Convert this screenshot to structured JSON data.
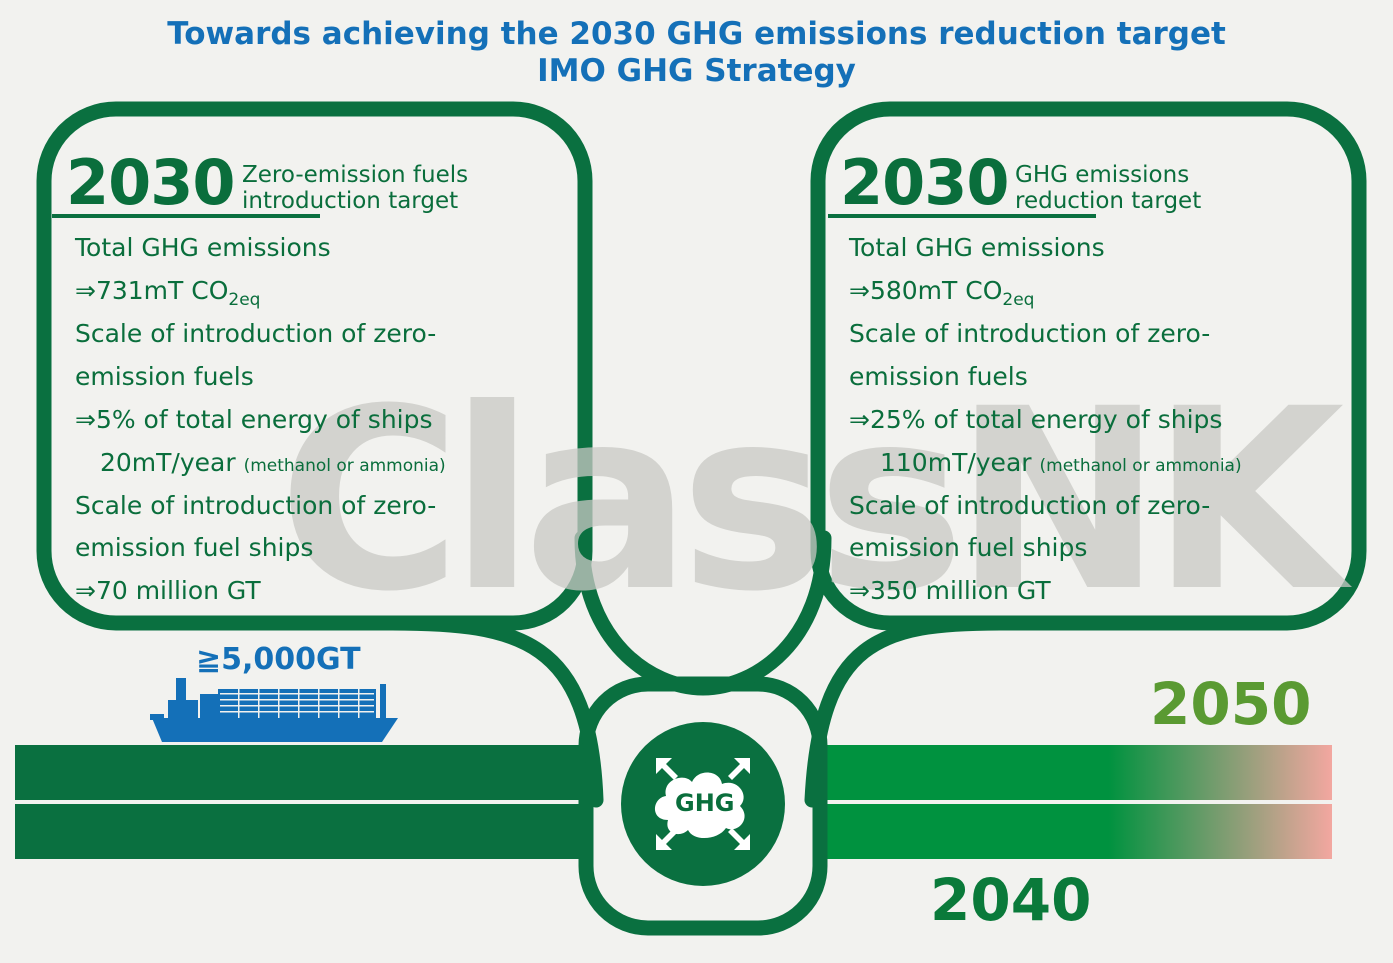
{
  "title_line1": "Towards achieving the 2030 GHG emissions reduction target",
  "title_line2": "IMO GHG Strategy",
  "watermark": "ClassNK",
  "left_box": {
    "year": "2030",
    "caption_line1": "Zero-emission fuels",
    "caption_line2": "introduction target",
    "l1": "Total GHG emissions",
    "l2": "⇒731mT CO",
    "l2_sub": "2eq",
    "l3": "Scale of introduction of zero-",
    "l4": "emission fuels",
    "l5": "⇒5% of total energy of ships",
    "l6": "20mT/year",
    "l6_small": "(methanol or ammonia)",
    "l7": "Scale of introduction of zero-",
    "l8": "emission fuel ships",
    "l9": "⇒70 million GT"
  },
  "right_box": {
    "year": "2030",
    "caption_line1": "GHG emissions",
    "caption_line2": "reduction target",
    "l1": "Total GHG emissions",
    "l2": "⇒580mT CO",
    "l2_sub": "2eq",
    "l3": "Scale of introduction of zero-",
    "l4": "emission fuels",
    "l5": "⇒25% of total energy of ships",
    "l6": "110mT/year",
    "l6_small": "(methanol or ammonia)",
    "l7": "Scale of introduction of zero-",
    "l8": "emission fuel ships",
    "l9": "⇒350 million GT"
  },
  "ship_label": "≧5,000GT",
  "center_icon": {
    "label": "GHG",
    "icon": "ghg-compress-icon"
  },
  "year_2050": "2050",
  "year_2040": "2040",
  "colors": {
    "dark_green": "#0a7040",
    "bright_green": "#00923f",
    "pink": "#f3a7a0",
    "blue": "#1470b8"
  }
}
